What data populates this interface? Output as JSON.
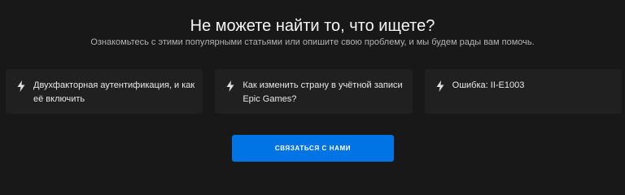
{
  "help": {
    "title": "Не можете найти то, что ищете?",
    "subtitle": "Ознакомьтесь с этими популярными статьями или опишите свою проблему, и мы будем рады вам помочь.",
    "articles": [
      {
        "icon": "lightning-bolt-icon",
        "label": "Двухфакторная аутентификация, и как её включить"
      },
      {
        "icon": "lightning-bolt-icon",
        "label": "Как изменить страну в учётной записи Epic Games?"
      },
      {
        "icon": "lightning-bolt-icon",
        "label": "Ошибка: II-E1003"
      }
    ],
    "contact_button": "СВЯЗАТЬСЯ С НАМИ"
  },
  "colors": {
    "background": "#181818",
    "card": "#202020",
    "accent": "#0074e4"
  }
}
